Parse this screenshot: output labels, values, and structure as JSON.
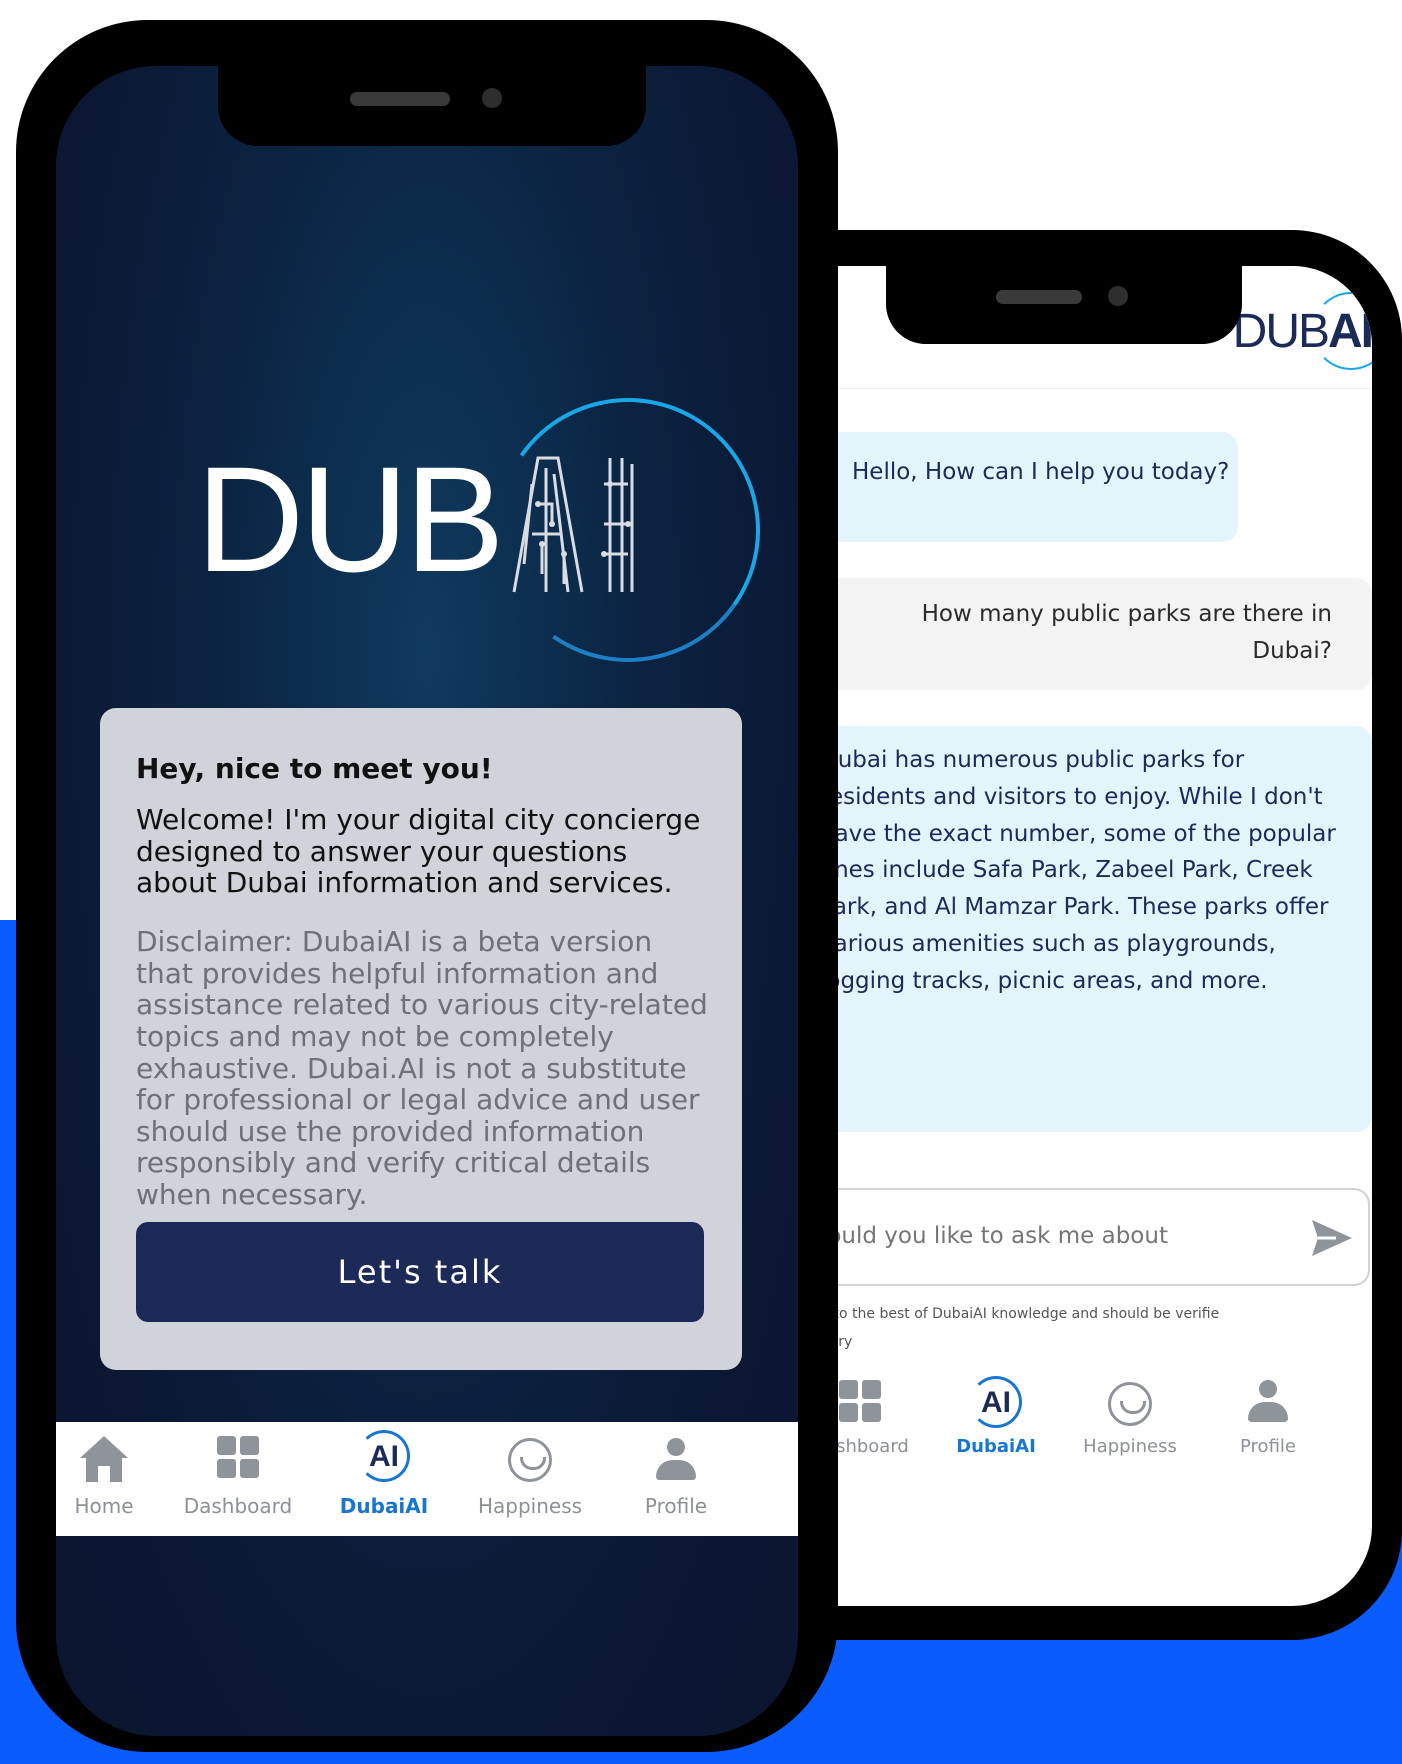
{
  "brand": {
    "logo_left": "DUB",
    "logo_right_a": "DUB",
    "logo_right_b": "AI"
  },
  "welcome_card": {
    "title": "Hey, nice to meet you!",
    "welcome": "Welcome! I'm your digital city concierge designed to answer your questions about Dubai information and services.",
    "disclaimer": "Disclaimer: DubaiAI is a beta version that provides helpful information and assistance related to various city-related topics and may not be completely exhaustive. Dubai.AI is not a substitute for professional or legal advice and user should use the provided information responsibly and verify critical details when necessary.",
    "button_label": "Let's talk"
  },
  "nav_left": [
    {
      "label": "Home",
      "icon": "home-icon"
    },
    {
      "label": "Dashboard",
      "icon": "dashboard-icon"
    },
    {
      "label": "DubaiAI",
      "icon": "dubai-ai-icon",
      "active": true
    },
    {
      "label": "Happiness",
      "icon": "happiness-icon"
    },
    {
      "label": "Profile",
      "icon": "profile-icon"
    }
  ],
  "chat": {
    "greeting": "Hello, How can I help you today?",
    "user_question": "How many public parks are there in Dubai?",
    "answer": "Dubai has numerous public parks for residents and visitors to enjoy. While I don't have the exact number, some of the popular ones include Safa Park, Zabeel Park, Creek Park, and Al Mamzar Park. These parks offer various amenities such as playgrounds, jogging tracks, picnic areas, and more.",
    "input_placeholder": "t would you like to ask me about?",
    "note_line1": "provided is to the best of DubaiAI knowledge and should be verified",
    "note_line2": "n necessary"
  },
  "nav_right": [
    {
      "label": "Dashboard",
      "icon": "dashboard-icon"
    },
    {
      "label": "DubaiAI",
      "icon": "dubai-ai-icon",
      "active": true
    },
    {
      "label": "Happiness",
      "icon": "happiness-icon"
    },
    {
      "label": "Profile",
      "icon": "profile-icon"
    }
  ],
  "icons": {
    "ai_badge": "AI"
  },
  "colors": {
    "accent_blue": "#0a5cff",
    "button_navy": "#1b2a57",
    "active_nav": "#1876d1",
    "bubble_blue": "#e3f4fb"
  }
}
